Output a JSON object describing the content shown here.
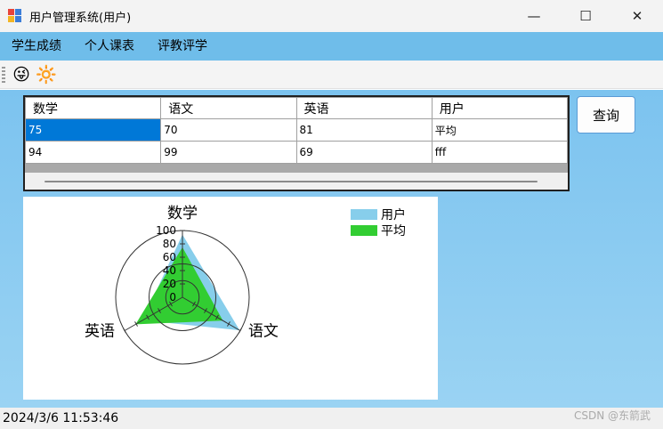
{
  "window": {
    "title": "用户管理系统(用户)",
    "minimize_icon": "—",
    "maximize_icon": "☐",
    "close_icon": "✕"
  },
  "menu": [
    {
      "label": "学生成绩"
    },
    {
      "label": "个人课表"
    },
    {
      "label": "评教评学"
    }
  ],
  "toolbar": [
    {
      "icon": "😜",
      "name": "emoji-face-icon"
    },
    {
      "icon": "🔆",
      "name": "sun-icon"
    }
  ],
  "grid": {
    "columns": [
      "数学",
      "语文",
      "英语",
      "用户"
    ],
    "rows": [
      [
        "75",
        "70",
        "81",
        "平均"
      ],
      [
        "94",
        "99",
        "69",
        "fff"
      ]
    ],
    "selected_cell": [
      0,
      0
    ]
  },
  "query_button": {
    "label": "查询"
  },
  "chart_data": {
    "type": "radar",
    "axes": [
      "数学",
      "语文",
      "英语"
    ],
    "r_ticks": [
      "0",
      "20",
      "40",
      "60",
      "80",
      "100"
    ],
    "rlim": [
      0,
      100
    ],
    "legend": [
      "用户",
      "平均"
    ],
    "legend_position": "top-right",
    "series": [
      {
        "name": "用户",
        "values": [
          94,
          99,
          69
        ],
        "color": "#87ceeb"
      },
      {
        "name": "平均",
        "values": [
          75,
          70,
          81
        ],
        "color": "#32cd32"
      }
    ]
  },
  "status": {
    "datetime": "2024/3/6 11:53:46",
    "watermark": "CSDN @东箭武"
  }
}
